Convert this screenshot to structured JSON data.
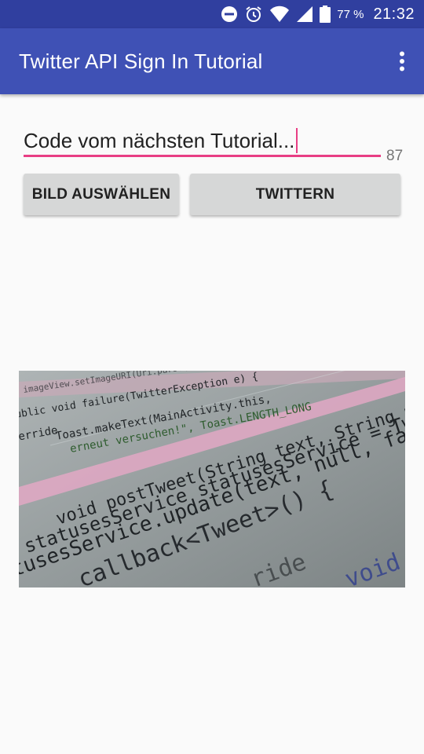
{
  "status_bar": {
    "icons": [
      "do-not-disturb-icon",
      "alarm-icon",
      "wifi-icon",
      "signal-icon",
      "battery-icon"
    ],
    "battery_percent": "77 %",
    "time": "21:32"
  },
  "app_bar": {
    "title": "Twitter API Sign In Tutorial",
    "overflow_icon": "more-vert-icon"
  },
  "tweet_input": {
    "value": "Code vom nächsten Tutorial...",
    "remaining_chars": "87"
  },
  "buttons": {
    "pick_image": "BILD AUSWÄHLEN",
    "tweet": "TWITTERN"
  },
  "image": {
    "code_lines": [
      "imageView.setImageURI(Uri.parse(",
      "ublic void failure(TwitterException e) {",
      "Toast.makeText(MainActivity.this,",
      "erneut versuchen!\", Toast.LENGTH_LONG",
      "verride",
      "void postTweet(String text, String media",
      "statusesService statusesService = Twitter",
      "tusesService.update(text, null, fal",
      "callback<Tweet>() {",
      "void s",
      "ride"
    ]
  },
  "colors": {
    "status_bar": "#303f9f",
    "app_bar": "#3f51b5",
    "accent": "#e83e84",
    "button_bg": "#d6d7d7"
  }
}
